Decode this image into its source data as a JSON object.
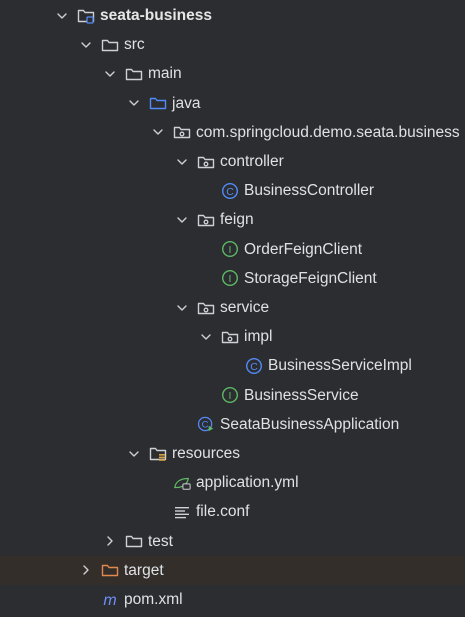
{
  "tree": {
    "items": [
      {
        "label": "seata-business",
        "depth": 0,
        "expanded": true,
        "icon": "module-folder-icon",
        "bold": true
      },
      {
        "label": "src",
        "depth": 1,
        "expanded": true,
        "icon": "folder-icon"
      },
      {
        "label": "main",
        "depth": 2,
        "expanded": true,
        "icon": "folder-icon"
      },
      {
        "label": "java",
        "depth": 3,
        "expanded": true,
        "icon": "source-folder-icon"
      },
      {
        "label": "com.springcloud.demo.seata.business",
        "depth": 4,
        "expanded": true,
        "icon": "package-icon"
      },
      {
        "label": "controller",
        "depth": 5,
        "expanded": true,
        "icon": "package-icon"
      },
      {
        "label": "BusinessController",
        "depth": 6,
        "icon": "class-icon"
      },
      {
        "label": "feign",
        "depth": 5,
        "expanded": true,
        "icon": "package-icon"
      },
      {
        "label": "OrderFeignClient",
        "depth": 6,
        "icon": "interface-icon"
      },
      {
        "label": "StorageFeignClient",
        "depth": 6,
        "icon": "interface-icon"
      },
      {
        "label": "service",
        "depth": 5,
        "expanded": true,
        "icon": "package-icon"
      },
      {
        "label": "impl",
        "depth": 6,
        "expanded": true,
        "icon": "package-icon"
      },
      {
        "label": "BusinessServiceImpl",
        "depth": 7,
        "icon": "class-icon"
      },
      {
        "label": "BusinessService",
        "depth": 6,
        "icon": "interface-icon"
      },
      {
        "label": "SeataBusinessApplication",
        "depth": 5,
        "icon": "spring-boot-class-icon",
        "nochev": true
      },
      {
        "label": "resources",
        "depth": 3,
        "expanded": true,
        "icon": "resources-folder-icon"
      },
      {
        "label": "application.yml",
        "depth": 4,
        "icon": "yaml-icon",
        "nochev": true
      },
      {
        "label": "file.conf",
        "depth": 4,
        "icon": "text-file-icon",
        "nochev": true
      },
      {
        "label": "test",
        "depth": 2,
        "expanded": false,
        "icon": "folder-icon"
      },
      {
        "label": "target",
        "depth": 1,
        "expanded": false,
        "icon": "excluded-folder-icon",
        "highlight": true
      },
      {
        "label": "pom.xml",
        "depth": 1,
        "icon": "maven-icon",
        "nochev": true
      }
    ]
  },
  "colors": {
    "background": "#2b2d30",
    "text": "#dfe1e5",
    "folder": "#ced0d6",
    "source_folder": "#548af7",
    "class": "#548af7",
    "interface": "#5fb865",
    "excluded_folder": "#e0894f",
    "highlight_row": "#3d352c"
  }
}
